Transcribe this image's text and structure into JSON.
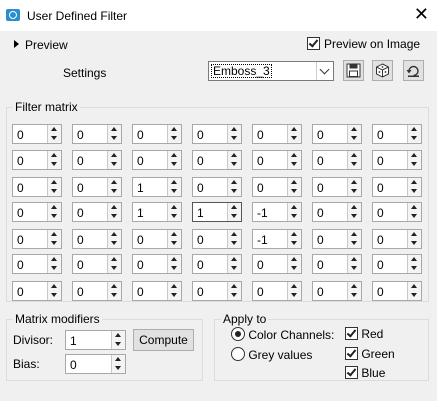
{
  "window": {
    "title": "User Defined Filter",
    "close_glyph": "✕"
  },
  "preview": {
    "label": "Preview",
    "preview_on_image_label": "Preview on Image",
    "preview_on_image_checked": true
  },
  "settings": {
    "label": "Settings",
    "selected": "Emboss_3"
  },
  "toolbar_icons": [
    "save-icon",
    "random-icon",
    "reset-icon"
  ],
  "matrix": {
    "legend": "Filter matrix",
    "rows": [
      [
        "0",
        "0",
        "0",
        "0",
        "0",
        "0",
        "0"
      ],
      [
        "0",
        "0",
        "0",
        "0",
        "0",
        "0",
        "0"
      ],
      [
        "0",
        "0",
        "1",
        "0",
        "0",
        "0",
        "0"
      ],
      [
        "0",
        "0",
        "1",
        "1",
        "-1",
        "0",
        "0"
      ],
      [
        "0",
        "0",
        "0",
        "0",
        "-1",
        "0",
        "0"
      ],
      [
        "0",
        "0",
        "0",
        "0",
        "0",
        "0",
        "0"
      ],
      [
        "0",
        "0",
        "0",
        "0",
        "0",
        "0",
        "0"
      ]
    ]
  },
  "modifiers": {
    "legend": "Matrix modifiers",
    "divisor_label": "Divisor:",
    "divisor_value": "1",
    "bias_label": "Bias:",
    "bias_value": "0",
    "compute_label": "Compute"
  },
  "apply_to": {
    "legend": "Apply to",
    "color_channels_label": "Color Channels:",
    "color_channels_selected": true,
    "grey_values_label": "Grey values",
    "grey_values_selected": false,
    "channels": [
      {
        "label": "Red",
        "checked": true
      },
      {
        "label": "Green",
        "checked": true
      },
      {
        "label": "Blue",
        "checked": true
      }
    ]
  }
}
